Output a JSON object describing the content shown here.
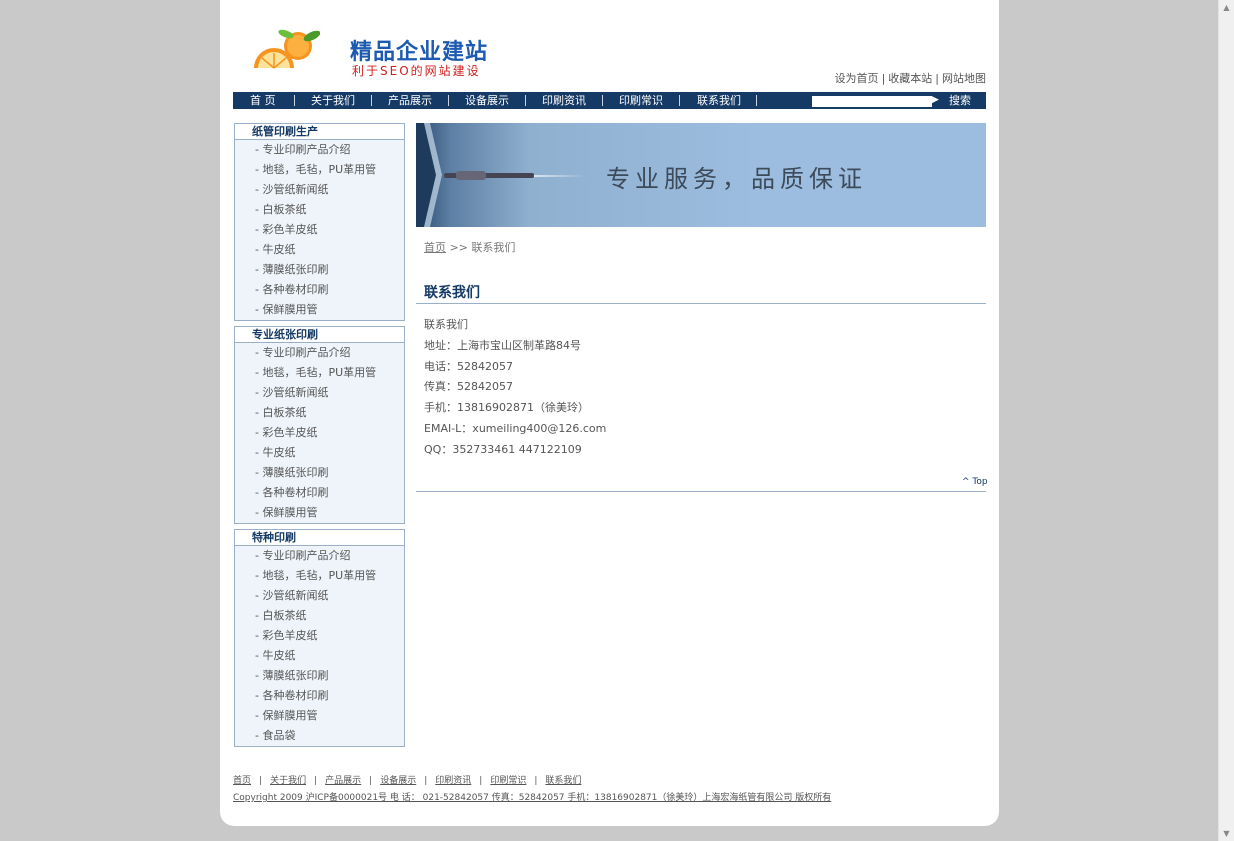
{
  "header": {
    "logo_title": "精品企业建站",
    "logo_subtitle": "利于SEO的网站建设",
    "top_links": [
      "设为首页",
      "收藏本站",
      "网站地图"
    ]
  },
  "nav": {
    "items": [
      "首 页",
      "关于我们",
      "产品展示",
      "设备展示",
      "印刷资讯",
      "印刷常识",
      "联系我们"
    ],
    "search_button": "搜索",
    "search_value": ""
  },
  "sidebar": {
    "categories": [
      {
        "title": "纸管印刷生产",
        "items": [
          "- 专业印刷产品介绍",
          "- 地毯，毛毡，PU革用管",
          "- 沙管纸新闻纸",
          "- 白板茶纸",
          "- 彩色羊皮纸",
          "- 牛皮纸",
          "- 薄膜纸张印刷",
          "- 各种卷材印刷",
          "- 保鲜膜用管"
        ]
      },
      {
        "title": "专业纸张印刷",
        "items": [
          "- 专业印刷产品介绍",
          "- 地毯，毛毡，PU革用管",
          "- 沙管纸新闻纸",
          "- 白板茶纸",
          "- 彩色羊皮纸",
          "- 牛皮纸",
          "- 薄膜纸张印刷",
          "- 各种卷材印刷",
          "- 保鲜膜用管"
        ]
      },
      {
        "title": "特种印刷",
        "items": [
          "- 专业印刷产品介绍",
          "- 地毯，毛毡，PU革用管",
          "- 沙管纸新闻纸",
          "- 白板茶纸",
          "- 彩色羊皮纸",
          "- 牛皮纸",
          "- 薄膜纸张印刷",
          "- 各种卷材印刷",
          "- 保鲜膜用管",
          "- 食品袋"
        ]
      }
    ]
  },
  "banner": {
    "text": "专业服务，品质保证"
  },
  "breadcrumb": {
    "home": "首页",
    "current": ">> 联系我们"
  },
  "content": {
    "title": "联系我们",
    "lines": [
      "联系我们",
      "地址：上海市宝山区制革路84号",
      "电话：52842057",
      "传真：52842057",
      "手机：13816902871（徐美玲）",
      "EMAI-L：xumeiling400@126.com",
      "QQ：352733461 447122109"
    ],
    "top_link": "^ Top"
  },
  "footer": {
    "links": [
      "首页",
      "关于我们",
      "产品展示",
      "设备展示",
      "印刷资讯",
      "印刷常识",
      "联系我们"
    ],
    "copyright": "Copyright 2009 沪ICP备0000021号 电 话： 021-52842057 传真：52842057 手机：13816902871（徐美玲）上海宏海纸管有限公司 版权所有"
  },
  "colors": {
    "nav_bg": "#163a66",
    "sidebar_bg": "#eef4fa",
    "border": "#9ab0c9"
  }
}
